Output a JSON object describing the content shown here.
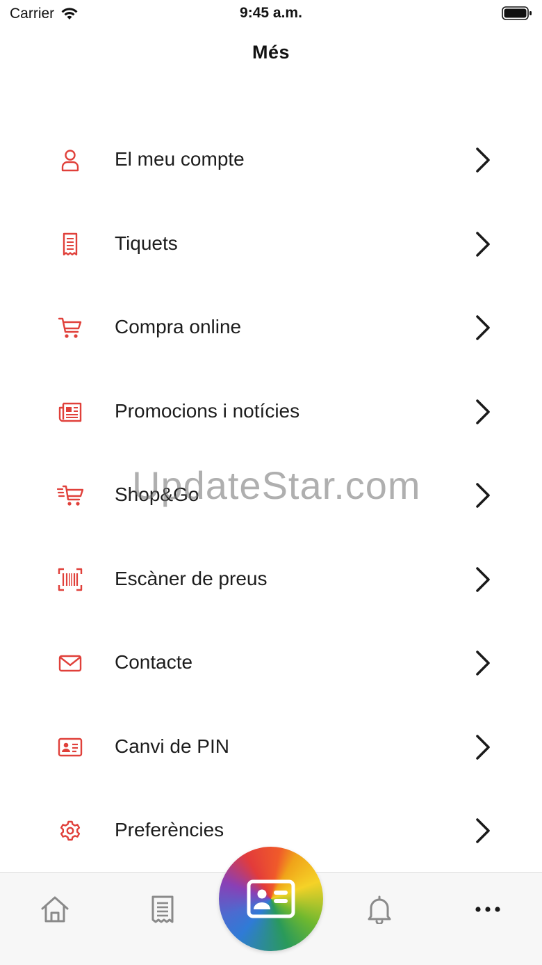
{
  "status_bar": {
    "carrier": "Carrier",
    "time": "9:45 a.m."
  },
  "header": {
    "title": "Més"
  },
  "menu": {
    "items": [
      {
        "label": "El meu compte",
        "icon": "user-icon"
      },
      {
        "label": "Tiquets",
        "icon": "receipt-icon"
      },
      {
        "label": "Compra online",
        "icon": "cart-icon"
      },
      {
        "label": "Promocions i notícies",
        "icon": "newspaper-icon"
      },
      {
        "label": "Shop&Go",
        "icon": "fast-cart-icon"
      },
      {
        "label": "Escàner de preus",
        "icon": "barcode-scan-icon"
      },
      {
        "label": "Contacte",
        "icon": "envelope-icon"
      },
      {
        "label": "Canvi de PIN",
        "icon": "id-card-icon"
      },
      {
        "label": "Preferències",
        "icon": "gear-icon"
      }
    ]
  },
  "watermark": "UpdateStar.com",
  "tab_bar": {
    "tabs": [
      {
        "icon": "home-icon"
      },
      {
        "icon": "receipt-icon"
      },
      {
        "icon": "id-card-icon",
        "center": true
      },
      {
        "icon": "bell-icon"
      },
      {
        "icon": "more-icon"
      }
    ]
  },
  "colors": {
    "accent": "#e0403a",
    "tab_icon": "#8a8a8a",
    "text": "#1c1c1c"
  }
}
